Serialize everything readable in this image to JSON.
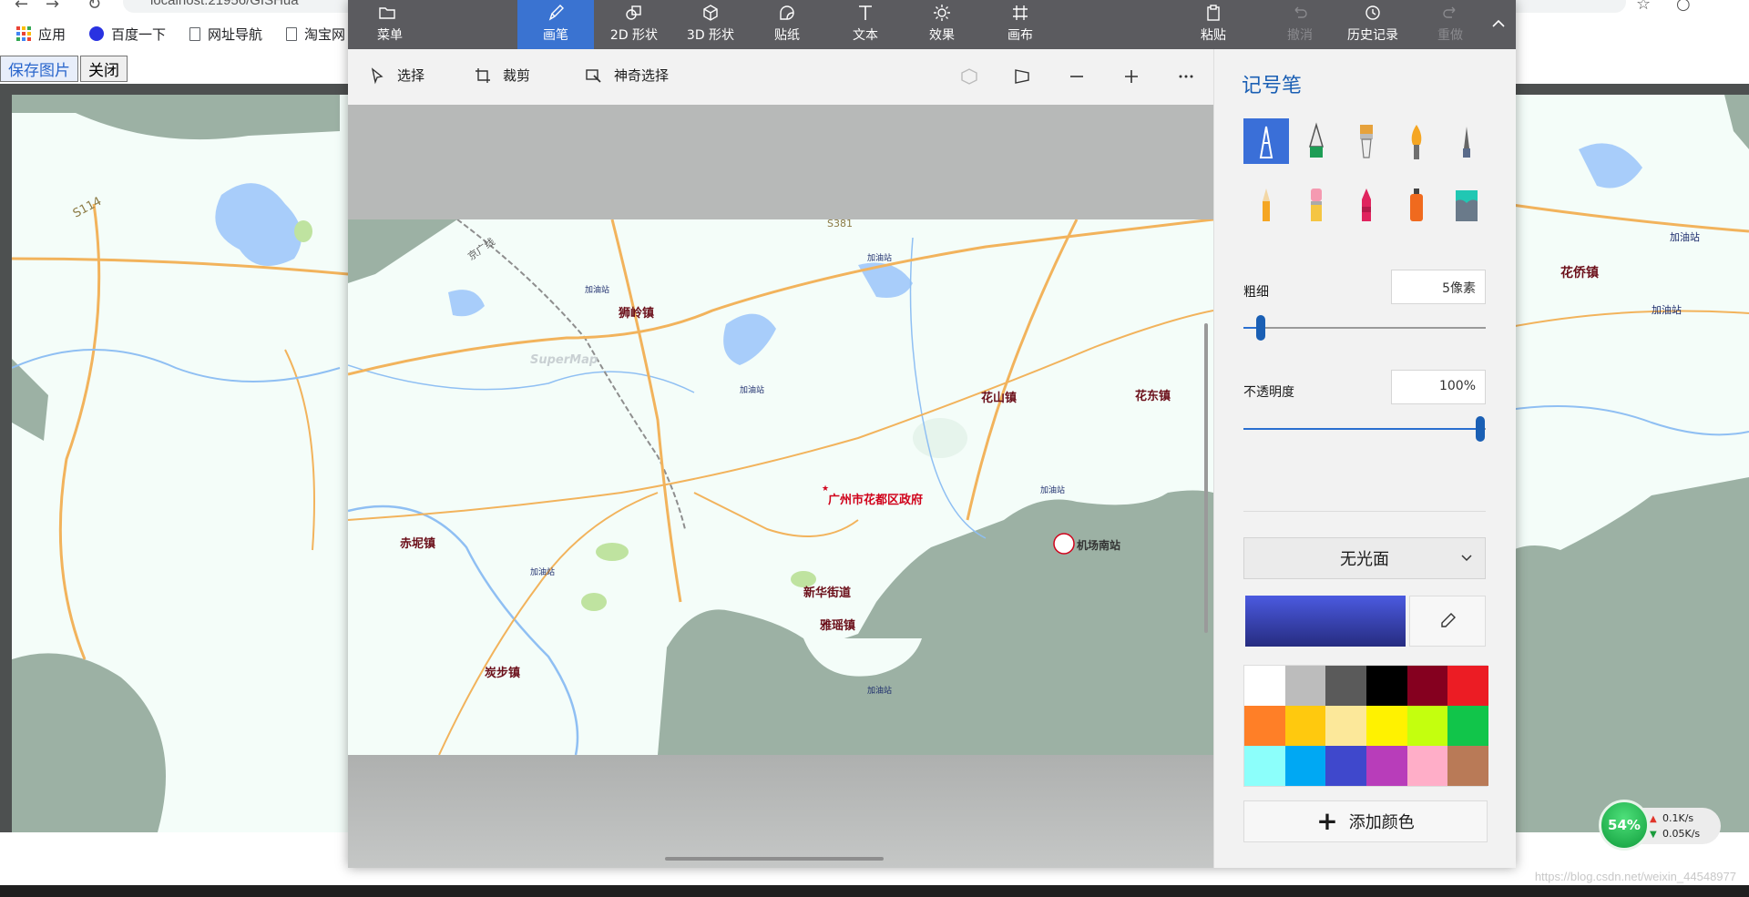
{
  "browser": {
    "url": "localhost:21956/GISHua",
    "bookmarks": [
      {
        "label": "应用",
        "icon": "apps-grid-icon"
      },
      {
        "label": "百度一下",
        "icon": "baidu-paw-icon"
      },
      {
        "label": "网址导航",
        "icon": "page-icon"
      },
      {
        "label": "淘宝网",
        "icon": "page-icon"
      }
    ]
  },
  "page": {
    "save_button": "保存图片",
    "close_button": "关闭"
  },
  "paint": {
    "ribbon": {
      "menu": "菜单",
      "brushes": "画笔",
      "shapes_2d": "2D 形状",
      "shapes_3d": "3D 形状",
      "stickers": "贴纸",
      "text": "文本",
      "effects": "效果",
      "canvas": "画布",
      "paste": "粘贴",
      "undo": "撤消",
      "history": "历史记录",
      "redo": "重做"
    },
    "toolbar": {
      "select": "选择",
      "crop": "裁剪",
      "magic_select": "神奇选择"
    },
    "panel": {
      "title": "记号笔",
      "thickness_label": "粗细",
      "thickness_value": "5像素",
      "thickness_fraction": 0.05,
      "opacity_label": "不透明度",
      "opacity_value": "100%",
      "opacity_fraction": 1.0,
      "finish": "无光面",
      "add_color": "添加颜色",
      "current_color": "#3b47c8",
      "palette": [
        "#ffffff",
        "#bcbcbc",
        "#5a5a5a",
        "#000000",
        "#85001f",
        "#ec1c24",
        "#ff7f27",
        "#ffc90e",
        "#fce89a",
        "#fff200",
        "#c4ff0e",
        "#11c54a",
        "#8cfffb",
        "#00a8f3",
        "#3f48cc",
        "#b83dba",
        "#ffaec8",
        "#b97a57"
      ],
      "brushes": [
        "marker-icon",
        "calligraphy-pen-icon",
        "oil-brush-icon",
        "watercolor-icon",
        "pixel-pen-icon",
        "pencil-icon",
        "eraser-icon",
        "crayon-icon",
        "spray-can-icon",
        "fill-bucket-icon"
      ]
    }
  },
  "map": {
    "towns": [
      "狮岭镇",
      "花山镇",
      "花东镇",
      "赤坭镇",
      "新华街道",
      "雅瑶镇",
      "炭步镇",
      "花侨镇"
    ],
    "government": "广州市花都区政府",
    "airport": "机场南站",
    "roads": [
      "S114",
      "S381",
      "京广线"
    ],
    "small_labels": [
      "加油站",
      "加油站",
      "加油站",
      "加油站",
      "加油站",
      "加油站"
    ],
    "watermark": "SuperMap"
  },
  "system": {
    "net_percent": "54%",
    "upload": "0.1K/s",
    "download": "0.05K/s",
    "blog_watermark": "https://blog.csdn.net/weixin_44548977"
  }
}
